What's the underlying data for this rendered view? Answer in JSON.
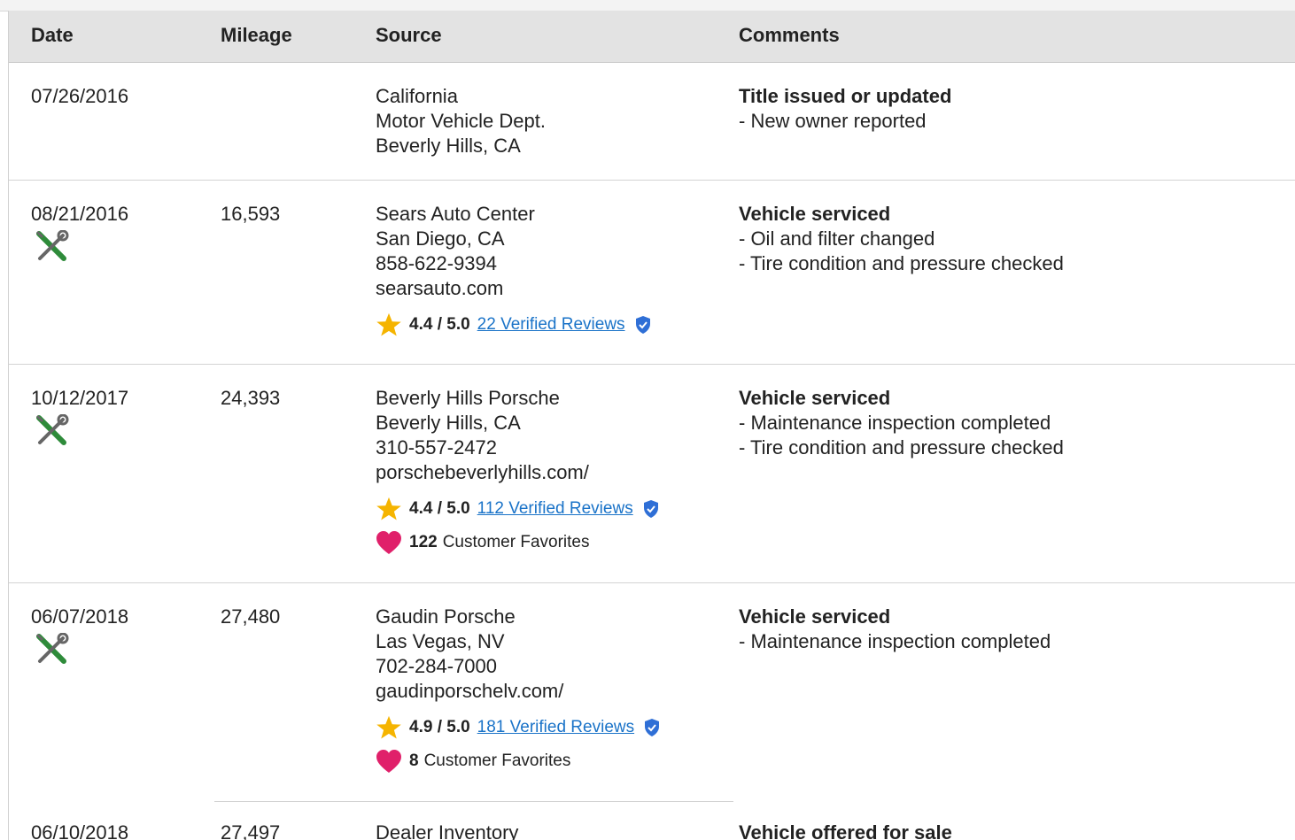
{
  "colors": {
    "header_bg": "#e3e3e3",
    "link": "#1a73c8",
    "star": "#f5b400",
    "heart": "#e0206a",
    "wrench_green": "#2e8b3a",
    "shield": "#2f6fd6"
  },
  "headers": {
    "date": "Date",
    "mileage": "Mileage",
    "source": "Source",
    "comments": "Comments"
  },
  "records": [
    {
      "date": "07/26/2016",
      "mileage": "",
      "service_icon": false,
      "source": [
        "California",
        "Motor Vehicle Dept.",
        "Beverly Hills, CA"
      ],
      "comment_title": "Title issued or updated",
      "comment_items": [
        "- New owner reported"
      ]
    },
    {
      "date": "08/21/2016",
      "mileage": "16,593",
      "service_icon": "wrench-screwdriver-icon",
      "source": [
        "Sears Auto Center",
        "San Diego, CA",
        "858-622-9394",
        "searsauto.com"
      ],
      "rating": {
        "score": "4.4 / 5.0",
        "reviews": "22 Verified Reviews"
      },
      "comment_title": "Vehicle serviced",
      "comment_items": [
        "- Oil and filter changed",
        "- Tire condition and pressure checked"
      ]
    },
    {
      "date": "10/12/2017",
      "mileage": "24,393",
      "service_icon": "wrench-screwdriver-icon",
      "source": [
        "Beverly Hills Porsche",
        "Beverly Hills, CA",
        "310-557-2472",
        "porschebeverlyhills.com/"
      ],
      "rating": {
        "score": "4.4 / 5.0",
        "reviews": "112 Verified Reviews"
      },
      "favorites": {
        "count": "122",
        "label": "Customer Favorites"
      },
      "comment_title": "Vehicle serviced",
      "comment_items": [
        "- Maintenance inspection completed",
        "- Tire condition and pressure checked"
      ]
    },
    {
      "date": "06/07/2018",
      "mileage": "27,480",
      "service_icon": "wrench-screwdriver-icon",
      "source": [
        "Gaudin Porsche",
        "Las Vegas, NV",
        "702-284-7000",
        "gaudinporschelv.com/"
      ],
      "rating": {
        "score": "4.9 / 5.0",
        "reviews": "181 Verified Reviews"
      },
      "favorites": {
        "count": "8",
        "label": "Customer Favorites"
      },
      "comment_title": "Vehicle serviced",
      "comment_items": [
        "- Maintenance inspection completed"
      ]
    },
    {
      "date": "06/10/2018",
      "mileage": "27,497",
      "source": [
        "Dealer Inventory"
      ],
      "comment_title": "Vehicle offered for sale",
      "comment_items": []
    }
  ]
}
